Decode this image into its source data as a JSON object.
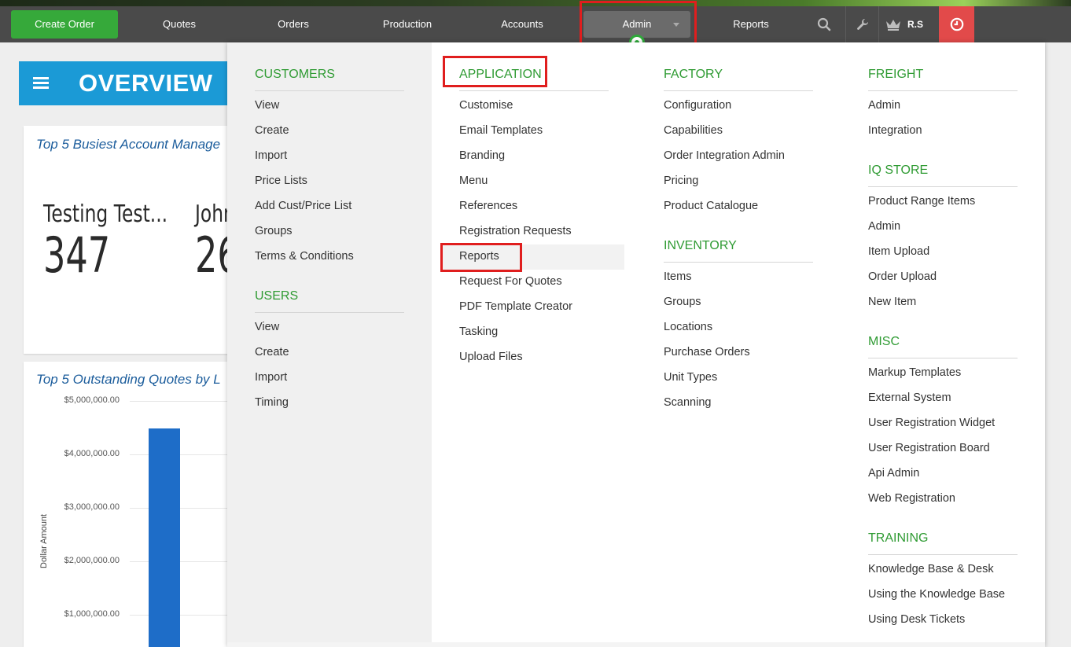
{
  "nav": {
    "create_order": "Create Order",
    "quotes": "Quotes",
    "orders": "Orders",
    "production": "Production",
    "accounts": "Accounts",
    "admin": "Admin",
    "reports": "Reports",
    "user_initials": "R.S",
    "icons": [
      "search-icon",
      "wrench-icon",
      "crown-icon",
      "clock-icon"
    ]
  },
  "page": {
    "title": "OVERVIEW",
    "card1_title": "Top 5 Busiest Account Manage",
    "card1_entries": [
      {
        "name": "Testing Test...",
        "value": "347"
      },
      {
        "name": "John",
        "value": "26"
      }
    ],
    "card2_title": "Top 5 Outstanding Quotes by L",
    "chart_data": {
      "type": "bar",
      "title": "Top 5 Outstanding Quotes by L",
      "ylabel": "Dollar Amount",
      "yticks": [
        "$5,000,000.00",
        "$4,000,000.00",
        "$3,000,000.00",
        "$2,000,000.00",
        "$1,000,000.00"
      ],
      "ylim": [
        0,
        5000000
      ],
      "values": [
        4480000
      ],
      "bar_color": "#1e6dc8"
    }
  },
  "menu": {
    "customers": {
      "title": "CUSTOMERS",
      "items": [
        "View",
        "Create",
        "Import",
        "Price Lists",
        "Add Cust/Price List",
        "Groups",
        "Terms & Conditions"
      ]
    },
    "users": {
      "title": "USERS",
      "items": [
        "View",
        "Create",
        "Import",
        "Timing"
      ]
    },
    "application": {
      "title": "APPLICATION",
      "items": [
        "Customise",
        "Email Templates",
        "Branding",
        "Menu",
        "References",
        "Registration Requests",
        "Reports",
        "Request For Quotes",
        "PDF Template Creator",
        "Tasking",
        "Upload Files"
      ]
    },
    "factory": {
      "title": "FACTORY",
      "items": [
        "Configuration",
        "Capabilities",
        "Order Integration Admin",
        "Pricing",
        "Product Catalogue"
      ]
    },
    "inventory": {
      "title": "INVENTORY",
      "items": [
        "Items",
        "Groups",
        "Locations",
        "Purchase Orders",
        "Unit Types",
        "Scanning"
      ]
    },
    "freight": {
      "title": "FREIGHT",
      "items": [
        "Admin",
        "Integration"
      ]
    },
    "iq_store": {
      "title": "IQ STORE",
      "items": [
        "Product Range Items",
        "Admin",
        "Item Upload",
        "Order Upload",
        "New Item"
      ]
    },
    "misc": {
      "title": "MISC",
      "items": [
        "Markup Templates",
        "External System",
        "User Registration Widget",
        "User Registration Board",
        "Api Admin",
        "Web Registration"
      ]
    },
    "training": {
      "title": "TRAINING",
      "items": [
        "Knowledge Base & Desk",
        "Using the Knowledge Base",
        "Using Desk Tickets"
      ]
    }
  },
  "colors": {
    "nav_bg": "#4a4a4a",
    "create_btn": "#36a93a",
    "clock_btn": "#e24a4a",
    "section_title": "#2f9b33",
    "overview_bg": "#1b9ad6",
    "highlight": "#e01e1e"
  }
}
